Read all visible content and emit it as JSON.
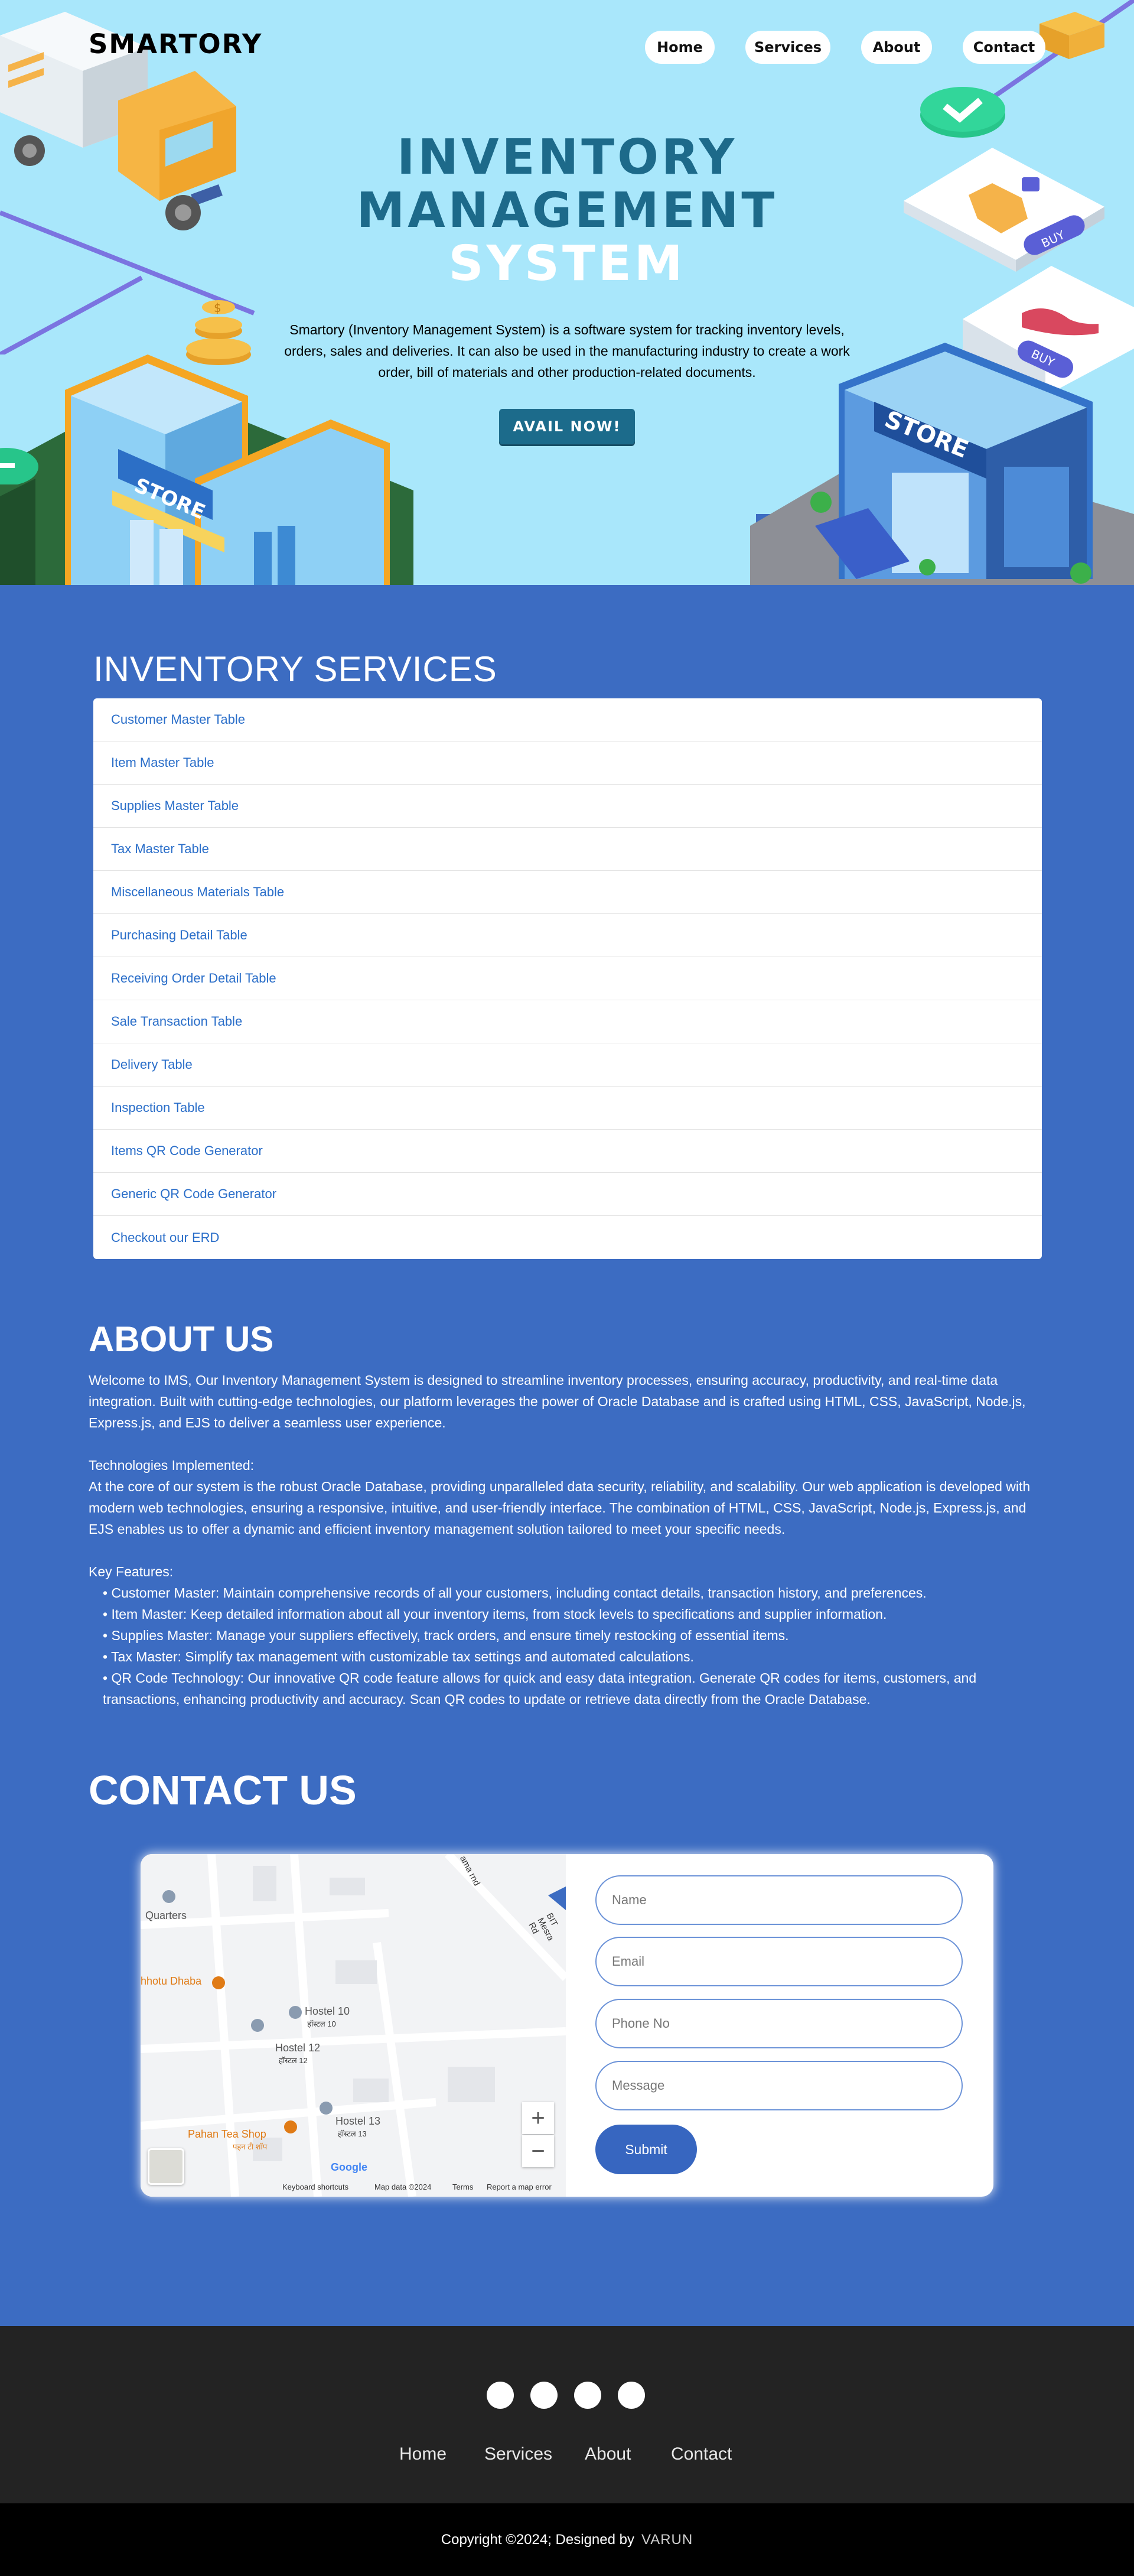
{
  "brand": "SMARTORY",
  "nav": [
    {
      "label": "Home"
    },
    {
      "label": "Services"
    },
    {
      "label": "About"
    },
    {
      "label": "Contact"
    }
  ],
  "hero": {
    "title_line1": "INVENTORY",
    "title_line2": "MANAGEMENT",
    "title_line3": "SYSTEM",
    "description": "Smartory (Inventory Management System) is a software system for tracking inventory levels, orders, sales and deliveries. It can also be used in the manufacturing industry to create a work order, bill of materials and other production-related documents.",
    "cta": "AVAIL NOW!",
    "store_sign": "STORE",
    "buy_tag": "BUY"
  },
  "services": {
    "heading": "INVENTORY SERVICES",
    "items": [
      "Customer Master Table",
      "Item Master Table",
      "Supplies Master Table",
      "Tax Master Table",
      "Miscellaneous Materials Table",
      "Purchasing Detail Table",
      "Receiving Order Detail Table",
      "Sale Transaction Table",
      "Delivery Table",
      "Inspection Table",
      "Items QR Code Generator",
      "Generic QR Code Generator",
      "Checkout our ERD"
    ]
  },
  "about": {
    "heading": "ABOUT US",
    "intro": "Welcome to IMS, Our Inventory Management System is designed to streamline inventory processes, ensuring accuracy, productivity, and real-time data integration. Built with cutting-edge technologies, our platform leverages the power of Oracle Database and is crafted using HTML, CSS, JavaScript, Node.js, Express.js, and EJS to deliver a seamless user experience.",
    "tech_title": "Technologies Implemented:",
    "tech_body": "At the core of our system is the robust Oracle Database, providing unparalleled data security, reliability, and scalability. Our web application is developed with modern web technologies, ensuring a responsive, intuitive, and user-friendly interface. The combination of HTML, CSS, JavaScript, Node.js, Express.js, and EJS enables us to offer a dynamic and efficient inventory management solution tailored to meet your specific needs.",
    "features_title": "Key Features:",
    "features": [
      "Customer Master: Maintain comprehensive records of all your customers, including contact details, transaction history, and preferences.",
      "Item Master: Keep detailed information about all your inventory items, from stock levels to specifications and supplier information.",
      "Supplies Master: Manage your suppliers effectively, track orders, and ensure timely restocking of essential items.",
      "Tax Master: Simplify tax management with customizable tax settings and automated calculations.",
      "QR Code Technology: Our innovative QR code feature allows for quick and easy data integration. Generate QR codes for items, customers, and transactions, enhancing productivity and accuracy. Scan QR codes to update or retrieve data directly from the Oracle Database."
    ]
  },
  "contact": {
    "heading": "CONTACT US",
    "name_placeholder": "Name",
    "email_placeholder": "Email",
    "phone_placeholder": "Phone No",
    "message_placeholder": "Message",
    "submit": "Submit",
    "map": {
      "labels": [
        "Quarters",
        "hhotu Dhaba",
        "Hostel 10",
        "हॉस्टल 10",
        "Hostel 12",
        "हॉस्टल 12",
        "Hostel 13",
        "हॉस्टल 13",
        "Pahan Tea Shop",
        "पहन टी शॉप",
        "BIT Mesra Rd",
        "ama rnd",
        "Google"
      ],
      "attribution": [
        "Keyboard shortcuts",
        "Map data ©2024",
        "Terms",
        "Report a map error"
      ],
      "zoom_in": "+",
      "zoom_out": "−"
    }
  },
  "footer": {
    "links": [
      "Home",
      "Services",
      "About",
      "Contact"
    ],
    "copyright": "Copyright ©2024; Designed by",
    "designer": "VARUN"
  }
}
